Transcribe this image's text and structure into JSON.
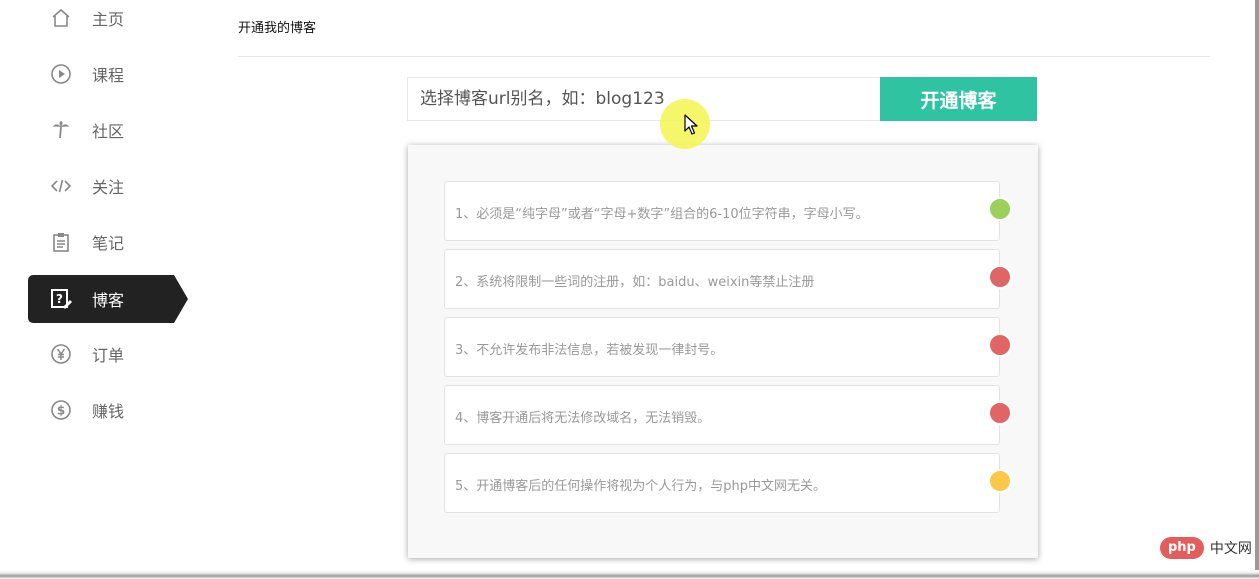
{
  "sidebar": {
    "items": [
      {
        "label": "主页",
        "icon": "home-icon"
      },
      {
        "label": "课程",
        "icon": "play-circle-icon"
      },
      {
        "label": "社区",
        "icon": "palm-tree-icon"
      },
      {
        "label": "关注",
        "icon": "code-icon"
      },
      {
        "label": "笔记",
        "icon": "clipboard-icon"
      },
      {
        "label": "博客",
        "icon": "blog-edit-icon",
        "active": true
      },
      {
        "label": "订单",
        "icon": "yen-circle-icon"
      },
      {
        "label": "赚钱",
        "icon": "dollar-circle-icon"
      }
    ]
  },
  "main": {
    "title": "开通我的博客",
    "alias_input": {
      "placeholder": "选择博客url别名，如：blog123",
      "value": ""
    },
    "open_button": "开通博客",
    "rules": [
      {
        "text": "1、必须是“纯字母”或者“字母+数字”组合的6-10位字符串，字母小写。",
        "color": "#9bd05a"
      },
      {
        "text": "2、系统将限制一些词的注册，如：baidu、weixin等禁止注册",
        "color": "#e06666"
      },
      {
        "text": "3、不允许发布非法信息，若被发现一律封号。",
        "color": "#e06666"
      },
      {
        "text": "4、博客开通后将无法修改域名，无法销毁。",
        "color": "#e06666"
      },
      {
        "text": "5、开通博客后的任何操作将视为个人行为，与php中文网无关。",
        "color": "#fcc84a"
      }
    ]
  },
  "colors": {
    "accent": "#2fc3a2",
    "sidebar_active": "#222222"
  },
  "watermark": {
    "logo": "php",
    "text": "中文网"
  }
}
